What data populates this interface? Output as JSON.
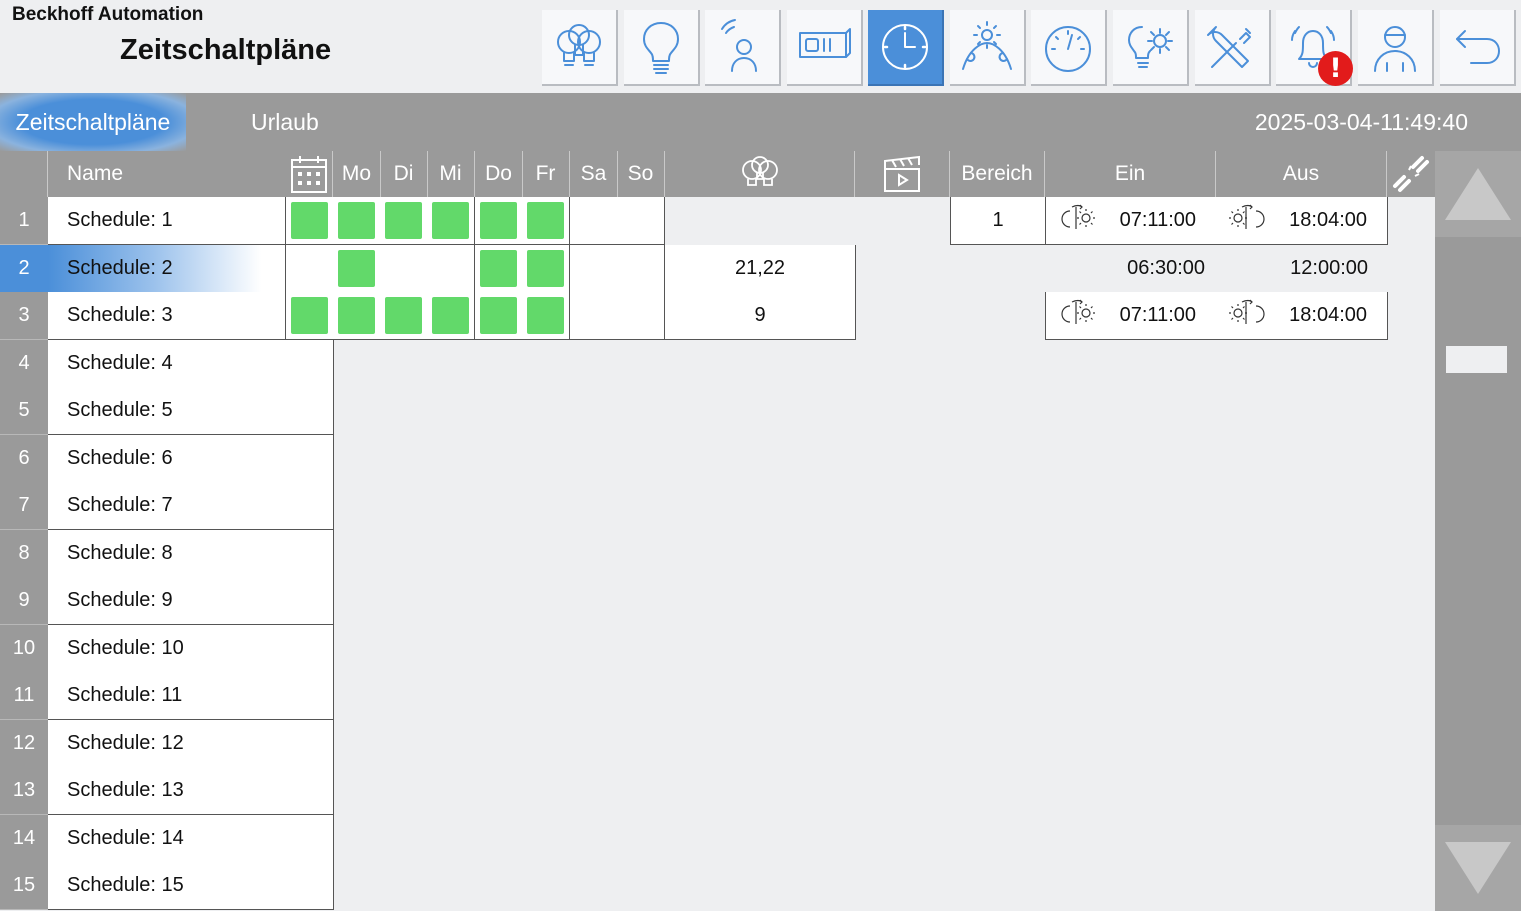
{
  "header": {
    "company": "Beckhoff Automation",
    "title": "Zeitschaltpläne",
    "alarm_badge": "!",
    "nav": [
      {
        "name": "nav-lighting-groups-button",
        "icon": "bulbs-group-icon",
        "active": false
      },
      {
        "name": "nav-lighting-button",
        "icon": "lightbulb-icon",
        "active": false
      },
      {
        "name": "nav-presence-button",
        "icon": "presence-sensor-icon",
        "active": false
      },
      {
        "name": "nav-sunblind-button",
        "icon": "window-blind-icon",
        "active": false
      },
      {
        "name": "nav-schedules-button",
        "icon": "clock-icon",
        "active": true
      },
      {
        "name": "nav-astro-button",
        "icon": "sun-moon-arc-icon",
        "active": false
      },
      {
        "name": "nav-gauge-button",
        "icon": "gauge-icon",
        "active": false
      },
      {
        "name": "nav-light-settings-button",
        "icon": "bulb-gear-icon",
        "active": false
      },
      {
        "name": "nav-tools-button",
        "icon": "tools-icon",
        "active": false
      },
      {
        "name": "nav-alarms-button",
        "icon": "bell-icon",
        "active": false
      },
      {
        "name": "nav-user-button",
        "icon": "user-icon",
        "active": false
      },
      {
        "name": "nav-back-button",
        "icon": "back-arrow-icon",
        "active": false
      }
    ]
  },
  "tabs": {
    "schedules": "Zeitschaltpläne",
    "holidays": "Urlaub",
    "datetime": "2025-03-04-11:49:40"
  },
  "columns": {
    "name": "Name",
    "days": [
      "Mo",
      "Di",
      "Mi",
      "Do",
      "Fr",
      "Sa",
      "So"
    ],
    "range": "Bereich",
    "on": "Ein",
    "off": "Aus"
  },
  "rows": [
    {
      "num": "1",
      "name": "Schedule: 1",
      "calendar": true,
      "days": [
        1,
        1,
        1,
        1,
        1,
        0,
        0
      ],
      "lights": "",
      "scene": "",
      "range": "1",
      "on": "07:11:00",
      "off": "18:04:00",
      "astro": true,
      "extent": "full"
    },
    {
      "num": "2",
      "name": "Schedule: 2",
      "calendar": false,
      "days": [
        1,
        0,
        0,
        1,
        1,
        0,
        0
      ],
      "lights": "21,22",
      "scene": "",
      "range": "",
      "on": "06:30:00",
      "off": "12:00:00",
      "astro": false,
      "extent": "lights"
    },
    {
      "num": "3",
      "name": "Schedule: 3",
      "calendar": true,
      "days": [
        1,
        1,
        1,
        1,
        1,
        0,
        0
      ],
      "lights": "9",
      "scene": "",
      "range": "",
      "on": "07:11:00",
      "off": "18:04:00",
      "astro": true,
      "extent": "lights"
    },
    {
      "num": "4",
      "name": "Schedule: 4"
    },
    {
      "num": "5",
      "name": "Schedule: 5"
    },
    {
      "num": "6",
      "name": "Schedule: 6"
    },
    {
      "num": "7",
      "name": "Schedule: 7"
    },
    {
      "num": "8",
      "name": "Schedule: 8"
    },
    {
      "num": "9",
      "name": "Schedule: 9"
    },
    {
      "num": "10",
      "name": "Schedule: 10"
    },
    {
      "num": "11",
      "name": "Schedule: 11"
    },
    {
      "num": "12",
      "name": "Schedule: 12"
    },
    {
      "num": "13",
      "name": "Schedule: 13"
    },
    {
      "num": "14",
      "name": "Schedule: 14"
    },
    {
      "num": "15",
      "name": "Schedule: 15"
    }
  ],
  "selected_row": 1,
  "colors": {
    "accent": "#4b8fd9",
    "active_day": "#62d96a",
    "header_gray": "#9a9a9a",
    "alarm": "#e21b1b"
  }
}
